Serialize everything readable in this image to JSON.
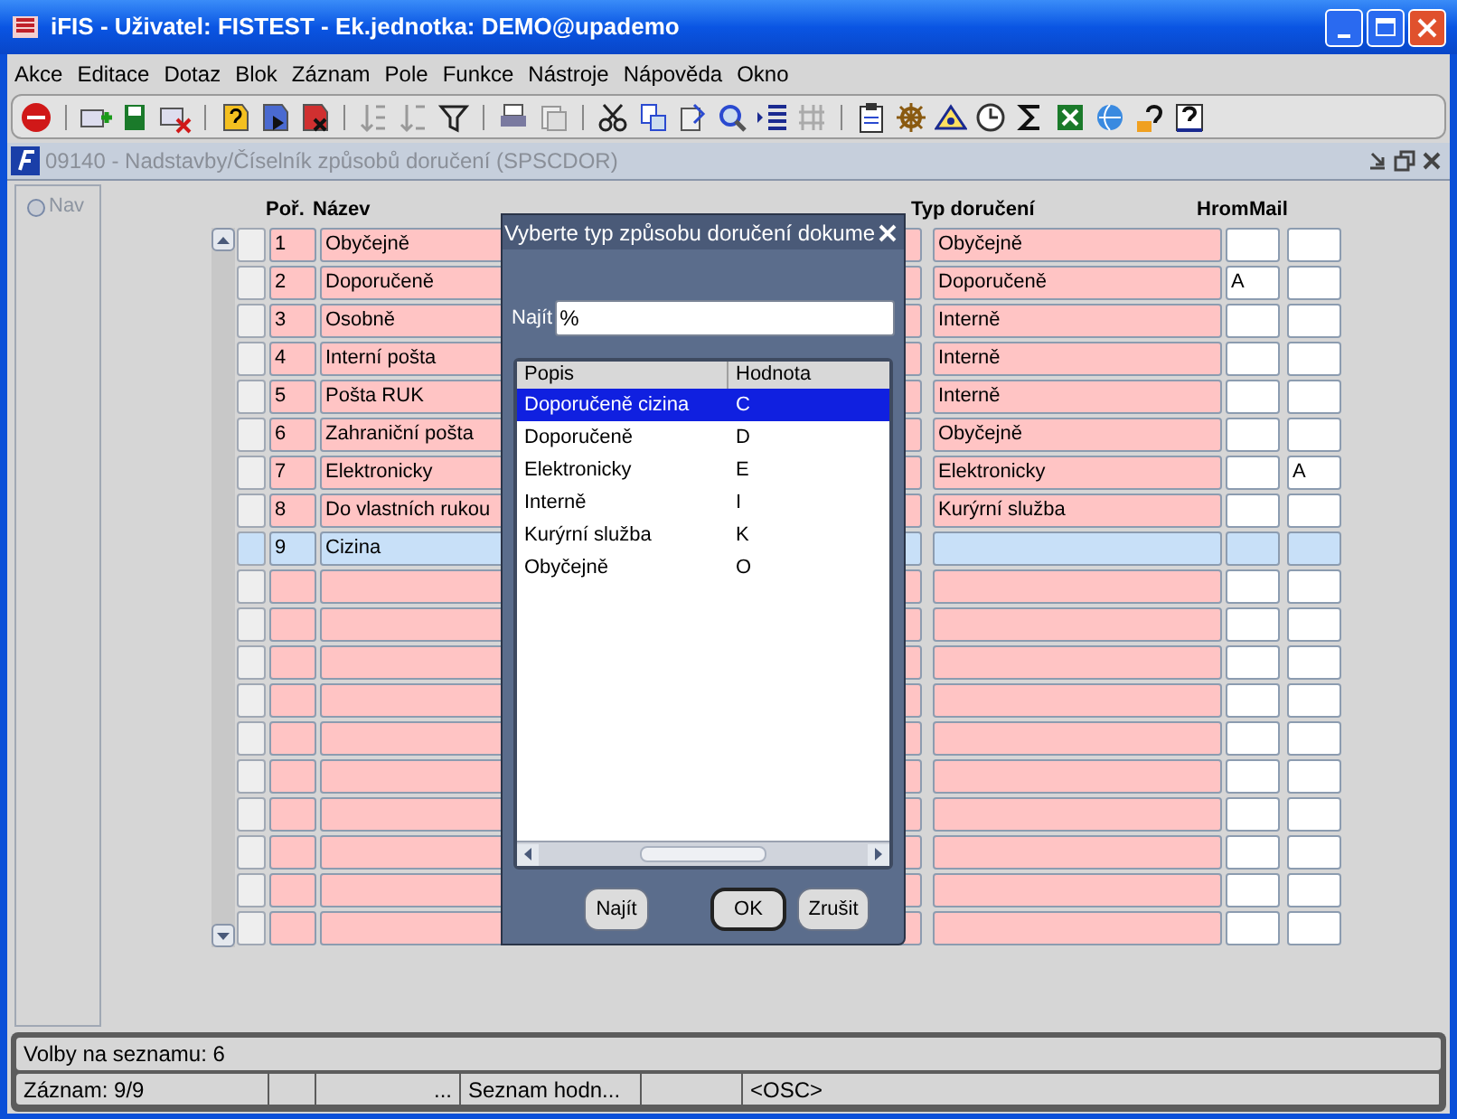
{
  "window": {
    "title": "iFIS - Uživatel: FISTEST - Ek.jednotka: DEMO@upademo"
  },
  "menu": [
    "Akce",
    "Editace",
    "Dotaz",
    "Blok",
    "Záznam",
    "Pole",
    "Funkce",
    "Nástroje",
    "Nápověda",
    "Okno"
  ],
  "form": {
    "title": "09140 - Nadstavby/Číselník způsobů doručení (SPSCDOR)",
    "nav": {
      "label": "Nav",
      "selected": false
    }
  },
  "grid": {
    "columns": [
      "Poř.",
      "Název",
      "Typ doručení",
      "Hrom",
      "Mail"
    ],
    "rows": [
      {
        "por": "1",
        "nazev": "Obyčejně",
        "typ": "Obyčejně",
        "hrom": "",
        "mail": "",
        "selected": false
      },
      {
        "por": "2",
        "nazev": "Doporučeně",
        "typ": "Doporučeně",
        "hrom": "A",
        "mail": "",
        "selected": false
      },
      {
        "por": "3",
        "nazev": "Osobně",
        "typ": "Interně",
        "hrom": "",
        "mail": "",
        "selected": false
      },
      {
        "por": "4",
        "nazev": "Interní pošta",
        "typ": "Interně",
        "hrom": "",
        "mail": "",
        "selected": false
      },
      {
        "por": "5",
        "nazev": "Pošta RUK",
        "typ": "Interně",
        "hrom": "",
        "mail": "",
        "selected": false
      },
      {
        "por": "6",
        "nazev": "Zahraniční pošta",
        "typ": "Obyčejně",
        "hrom": "",
        "mail": "",
        "selected": false
      },
      {
        "por": "7",
        "nazev": "Elektronicky",
        "typ": "Elektronicky",
        "hrom": "",
        "mail": "A",
        "selected": false
      },
      {
        "por": "8",
        "nazev": "Do vlastních rukou",
        "typ": "Kurýrní služba",
        "hrom": "",
        "mail": "",
        "selected": false
      },
      {
        "por": "9",
        "nazev": "Cizina",
        "typ": "",
        "hrom": "",
        "mail": "",
        "selected": true
      }
    ]
  },
  "dialog": {
    "title": "Vyberte typ způsobu doručení dokume",
    "find_label": "Najít",
    "find_value": "%",
    "columns": [
      "Popis",
      "Hodnota"
    ],
    "rows": [
      {
        "popis": "Doporučeně cizina",
        "hodnota": "C",
        "selected": true
      },
      {
        "popis": "Doporučeně",
        "hodnota": "D",
        "selected": false
      },
      {
        "popis": "Elektronicky",
        "hodnota": "E",
        "selected": false
      },
      {
        "popis": "Interně",
        "hodnota": "I",
        "selected": false
      },
      {
        "popis": "Kurýrní služba",
        "hodnota": "K",
        "selected": false
      },
      {
        "popis": "Obyčejně",
        "hodnota": "O",
        "selected": false
      }
    ],
    "buttons": [
      "Najít",
      "OK",
      "Zrušit"
    ]
  },
  "status_bar": {
    "message": "Volby na seznamu: 6",
    "record": "Záznam: 9/9",
    "segment_3": "...",
    "segment_4": "Seznam hodn...",
    "segment_6": "<OSC>"
  }
}
